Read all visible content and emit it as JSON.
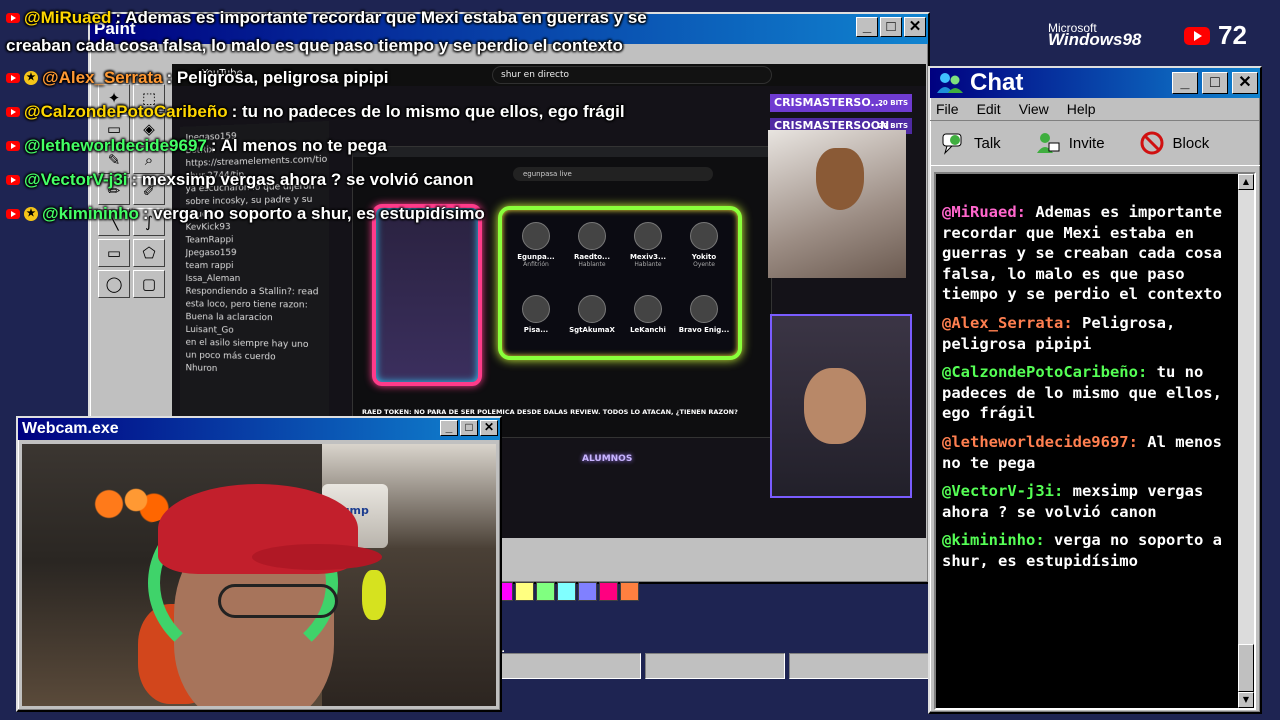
{
  "paint": {
    "title": "Paint",
    "palette": [
      "#ffff00",
      "#00ff00",
      "#00ffff",
      "#0000ff",
      "#ff00ff",
      "#ffff80",
      "#80ff80",
      "#80ffff",
      "#8080ff",
      "#ff0080",
      "#ff8040"
    ]
  },
  "stream": {
    "yt_label": "YouTube",
    "search_text": "shur en directo",
    "inner_search_text": "egunpasa live",
    "caption": "RAED TOKEN: NO PARA DE SER POLEMICA DESDE DALAS REVIEW. TODOS LO ATACAN, ¿TIENEN RAZON?",
    "alumnos": "ALUMNOS",
    "bits_user_1": "CRISMASTERSO...",
    "bits_user_2": "CRISMASTERSOON",
    "bits_amount": "20 BITS",
    "speakers": [
      {
        "name": "Egunpa...",
        "role": "Anfitrión"
      },
      {
        "name": "Raedto...",
        "role": "Hablante"
      },
      {
        "name": "Mexiv3...",
        "role": "Hablante"
      },
      {
        "name": "Yokito",
        "role": "Oyente"
      },
      {
        "name": "Pisa...",
        "role": ""
      },
      {
        "name": "SgtAkumaX",
        "role": ""
      },
      {
        "name": "LeKanchi",
        "role": ""
      },
      {
        "name": "Bravo Enig...",
        "role": ""
      }
    ],
    "mini_chat": [
      "Jpegaso159",
      "BotRix",
      "https://streamelements.com/tio",
      "shur-2744/tip",
      "ya escucharon lo que dijeron sobre incosky, su padre y su abuelo?",
      "KevKick93",
      "TeamRappi",
      "Jpegaso159",
      "team rappi",
      "Issa_Aleman",
      "Respondiendo a Stallin?: read esta loco, pero tiene razon: Buena la aclaracion",
      "Luisant_Go",
      "en el asilo siempre hay uno un poco más cuerdo",
      "Nhuron"
    ],
    "webcam_can_label": "Trump"
  },
  "overlay": {
    "lines": [
      {
        "user": "@MiRuaed",
        "msg": ": Ademas es importante recordar que Mexi estaba en guerras y se",
        "star": false,
        "color": "yellow"
      },
      {
        "user": "",
        "msg": "creaban cada cosa falsa, lo malo es que paso tiempo y se perdio el contexto",
        "star": false,
        "color": "yellow"
      },
      {
        "user": "@Alex_Serrata",
        "msg": ": Peligrosa, peligrosa pipipi",
        "star": true,
        "color": "orange"
      },
      {
        "user": "@CalzondePotoCaribeño",
        "msg": ": tu no padeces de lo mismo que ellos, ego frágil",
        "star": false,
        "color": "yellow"
      },
      {
        "user": "@letheworldecide9697",
        "msg": ": Al menos no te pega",
        "star": false,
        "color": "green"
      },
      {
        "user": "@VectorV-j3i",
        "msg": ": mexsimp vergas ahora ? se volvió canon",
        "star": false,
        "color": "green"
      },
      {
        "user": "@kimininho",
        "msg": ": verga no soporto a shur, es estupidísimo",
        "star": true,
        "color": "green"
      }
    ]
  },
  "branding": {
    "microsoft": "Microsoft",
    "windows": "Windows98",
    "viewers": "72"
  },
  "chat_window": {
    "title": "Chat",
    "menu": [
      "File",
      "Edit",
      "View",
      "Help"
    ],
    "tools": [
      "Talk",
      "Invite",
      "Block"
    ],
    "messages": [
      {
        "user": "@MiRuaed:",
        "text": " Ademas es importante recordar que Mexi estaba en guerras y se creaban cada cosa falsa, lo malo es que paso tiempo y se perdio el contexto",
        "color": "#ff66cc"
      },
      {
        "user": "@Alex_Serrata:",
        "text": " Peligrosa, peligrosa pipipi",
        "color": "#ff7f50"
      },
      {
        "user": "@CalzondePotoCaribeño:",
        "text": " tu no padeces de lo mismo que ellos, ego frágil",
        "color": "#55ff55"
      },
      {
        "user": "@letheworldecide9697:",
        "text": " Al menos no te pega",
        "color": "#ff7f50"
      },
      {
        "user": "@VectorV-j3i:",
        "text": " mexsimp vergas ahora ? se volvió canon",
        "color": "#55ff55"
      },
      {
        "user": "@kimininho:",
        "text": " verga no soporto a shur, es estupidísimo",
        "color": "#55ff55"
      }
    ]
  },
  "webcam": {
    "title": "Webcam.exe"
  }
}
